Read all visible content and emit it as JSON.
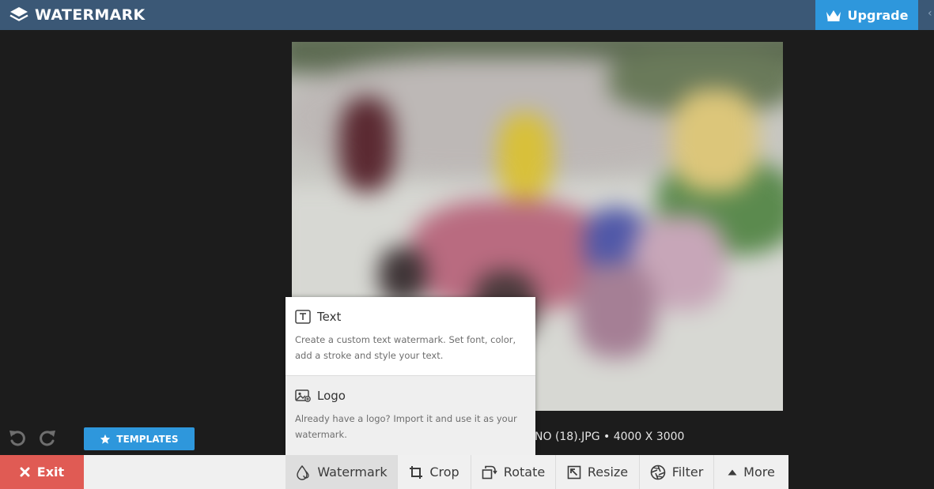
{
  "header": {
    "app_name": "WATERMARK",
    "upgrade_label": "Upgrade",
    "bg_color": "#3b5876",
    "accent_color": "#2e97dc"
  },
  "canvas": {
    "file_info": "NO (18).JPG • 4000 X 3000"
  },
  "watermark_menu": {
    "items": [
      {
        "icon": "text-box-icon",
        "title": "Text",
        "description": "Create a custom text watermark. Set font, color, add a stroke and style your text."
      },
      {
        "icon": "image-logo-icon",
        "title": "Logo",
        "description": "Already have a logo? Import it and use it as your watermark."
      }
    ]
  },
  "controls": {
    "templates_label": "TEMPLATES"
  },
  "toolbar": {
    "exit_label": "Exit",
    "exit_color": "#e05b54",
    "tools": [
      {
        "label": "Watermark",
        "icon": "watermark-drop-icon",
        "active": true
      },
      {
        "label": "Crop",
        "icon": "crop-icon",
        "active": false
      },
      {
        "label": "Rotate",
        "icon": "rotate-icon",
        "active": false
      },
      {
        "label": "Resize",
        "icon": "resize-icon",
        "active": false
      },
      {
        "label": "Filter",
        "icon": "filter-icon",
        "active": false
      },
      {
        "label": "More",
        "icon": "caret-up-icon",
        "active": false
      }
    ]
  }
}
